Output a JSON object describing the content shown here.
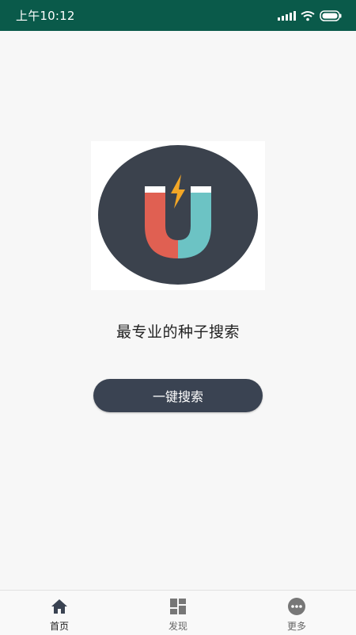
{
  "status_bar": {
    "time": "上午10:12",
    "background_color": "#0a5a4a"
  },
  "main": {
    "logo_icon": "magnet-logo-icon",
    "tagline": "最专业的种子搜索",
    "search_button_label": "一键搜索"
  },
  "bottom_nav": {
    "items": [
      {
        "label": "首页",
        "icon": "home-icon",
        "active": true
      },
      {
        "label": "发现",
        "icon": "grid-icon",
        "active": false
      },
      {
        "label": "更多",
        "icon": "more-icon",
        "active": false
      }
    ]
  },
  "colors": {
    "button": "#3a4352",
    "magnet_left": "#e06052",
    "magnet_right": "#6cc3c4",
    "bolt": "#f2a626"
  }
}
